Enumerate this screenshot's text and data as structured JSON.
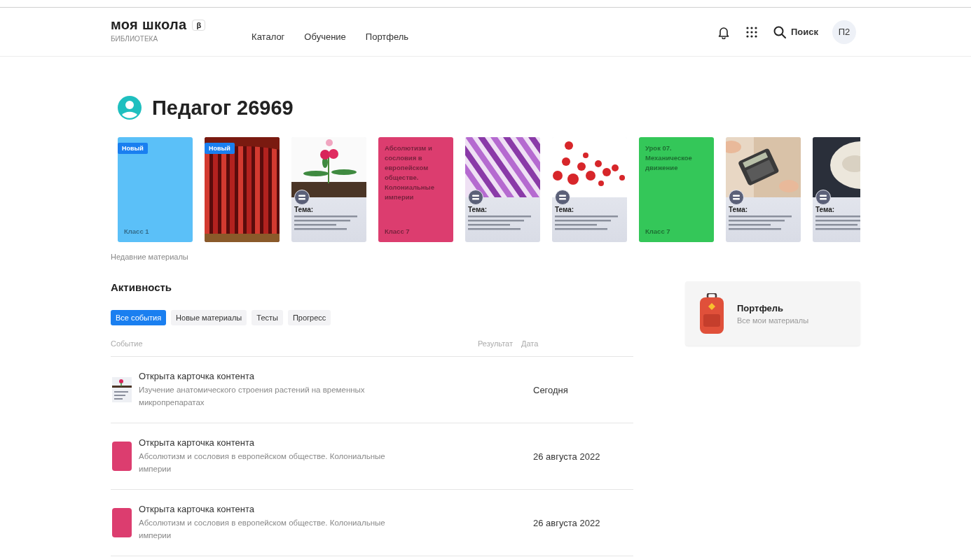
{
  "header": {
    "logo": "моя школа",
    "beta": "β",
    "subtitle": "БИБЛИОТЕКА",
    "nav": [
      {
        "label": "Каталог"
      },
      {
        "label": "Обучение"
      },
      {
        "label": "Портфель"
      }
    ],
    "search": "Поиск",
    "avatar": "П2"
  },
  "profile": {
    "name": "Педагог 26969"
  },
  "materials": [
    {
      "kind": "color",
      "color": "#5bc0f8",
      "badge": "Новый",
      "grade": "Класс 1"
    },
    {
      "kind": "picture",
      "badge": "Новый"
    },
    {
      "kind": "topic",
      "topic": "Тема:"
    },
    {
      "kind": "color",
      "color": "#dc3d6f",
      "title": "Абсолютизм и сословия в европейском обществе. Колониальные империи",
      "grade": "Класс 7"
    },
    {
      "kind": "topic",
      "topic": "Тема:"
    },
    {
      "kind": "topic",
      "topic": "Тема:"
    },
    {
      "kind": "color",
      "color": "#34c759",
      "title": "Урок 07. Механическое движение",
      "grade": "Класс 7"
    },
    {
      "kind": "topic",
      "topic": "Тема:"
    },
    {
      "kind": "topic",
      "topic": "Тема:"
    }
  ],
  "materials_caption": "Недавние материалы",
  "activity": {
    "title": "Активность",
    "filters": [
      {
        "label": "Все события",
        "selected": true
      },
      {
        "label": "Новые материалы",
        "selected": false
      },
      {
        "label": "Тесты",
        "selected": false
      },
      {
        "label": "Прогресс",
        "selected": false
      }
    ],
    "columns": {
      "event": "Событие",
      "result": "Результат",
      "date": "Дата"
    },
    "rows": [
      {
        "title": "Открыта карточка контента",
        "description": "Изучение анатомического строения растений на временных микропрепаратах",
        "date": "Сегодня"
      },
      {
        "thumb": {
          "kind": "color",
          "color": "#dc3d6f"
        },
        "title": "Открыта карточка контента",
        "description": "Абсолютизм и сословия в европейском обществе. Колониальные империи",
        "date": "26 августа 2022"
      },
      {
        "thumb": {
          "kind": "color",
          "color": "#dc3d6f"
        },
        "title": "Открыта карточка контента",
        "description": "Абсолютизм и сословия в европейском обществе. Колониальные империи",
        "date": "26 августа 2022"
      }
    ]
  },
  "portfolio": {
    "title": "Портфель",
    "subtitle": "Все мои материалы"
  }
}
